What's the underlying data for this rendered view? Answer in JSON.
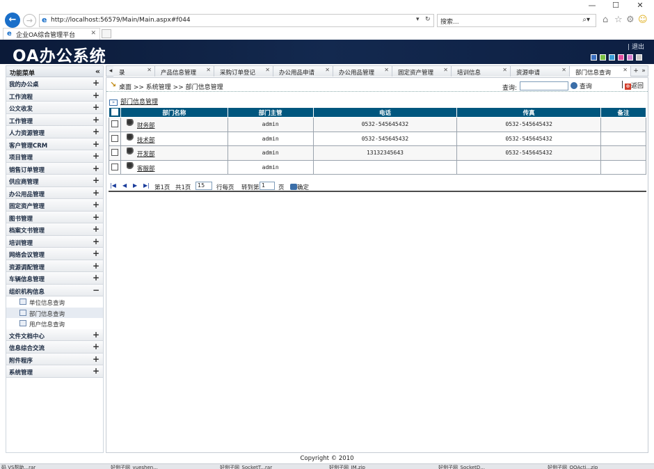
{
  "browser": {
    "address": "http://localhost:56579/Main/Main.aspx#f044",
    "search_placeholder": "搜索...",
    "tab_title": "企业OA综合管理平台",
    "window_min": "—",
    "window_max": "☐",
    "window_close": "✕"
  },
  "app": {
    "title": "OA办公系统",
    "logout": "退出",
    "theme_colors": [
      "#3a6fc0",
      "#7bc043",
      "#3b9dd8",
      "#e24ea0",
      "#d67fd0",
      "#c9c9c9"
    ]
  },
  "sidebar": {
    "title": "功能菜单",
    "collapse_icon": "«",
    "items_top": [
      {
        "label": "我的办公桌",
        "toggle": "+"
      },
      {
        "label": "工作流程",
        "toggle": "+"
      },
      {
        "label": "公文收发",
        "toggle": "+"
      },
      {
        "label": "工作管理",
        "toggle": "+"
      },
      {
        "label": "人力资源管理",
        "toggle": "+"
      },
      {
        "label": "客户管理CRM",
        "toggle": "+"
      },
      {
        "label": "项目管理",
        "toggle": "+"
      },
      {
        "label": "销售订单管理",
        "toggle": "+"
      },
      {
        "label": "供应商管理",
        "toggle": "+"
      },
      {
        "label": "办公用品管理",
        "toggle": "+"
      },
      {
        "label": "固定资产管理",
        "toggle": "+"
      },
      {
        "label": "图书管理",
        "toggle": "+"
      },
      {
        "label": "档案文书管理",
        "toggle": "+"
      },
      {
        "label": "培训管理",
        "toggle": "+"
      },
      {
        "label": "网络会议管理",
        "toggle": "+"
      },
      {
        "label": "资源调配管理",
        "toggle": "+"
      },
      {
        "label": "车辆信息管理",
        "toggle": "+"
      },
      {
        "label": "组织机构信息",
        "toggle": "−"
      }
    ],
    "subitems": [
      {
        "label": "单位信息查询",
        "active": false
      },
      {
        "label": "部门信息查询",
        "active": true
      },
      {
        "label": "用户信息查询",
        "active": false
      }
    ],
    "items_bottom": [
      {
        "label": "文件文档中心",
        "toggle": "+"
      },
      {
        "label": "信息综合交流",
        "toggle": "+"
      },
      {
        "label": "附件程序",
        "toggle": "+"
      },
      {
        "label": "系统管理",
        "toggle": "+"
      }
    ]
  },
  "tabs": {
    "prev": "◂",
    "add": "+",
    "overflow": "»",
    "items": [
      {
        "label": "录",
        "close": "✕",
        "active": false
      },
      {
        "label": "产品信息管理",
        "close": "✕",
        "active": false
      },
      {
        "label": "采购订单登记",
        "close": "✕",
        "active": false
      },
      {
        "label": "办公用品申请",
        "close": "✕",
        "active": false
      },
      {
        "label": "办公用品管理",
        "close": "✕",
        "active": false
      },
      {
        "label": "固定资产管理",
        "close": "✕",
        "active": false
      },
      {
        "label": "培训信息",
        "close": "✕",
        "active": false
      },
      {
        "label": "资源申请",
        "close": "✕",
        "active": false
      },
      {
        "label": "部门信息查询",
        "close": "✕",
        "active": true
      }
    ]
  },
  "breadcrumb": {
    "text": "桌面 >> 系统管理 >> 部门信息管理",
    "query_label": "查询:",
    "query_button": "查询",
    "back_label": "返回"
  },
  "section": {
    "title": "部门信息管理"
  },
  "table": {
    "headers": [
      "部门名称",
      "部门主管",
      "电话",
      "传真",
      "备注"
    ],
    "rows": [
      {
        "name": "财务部",
        "manager": "admin",
        "phone": "0532-545645432",
        "fax": "0532-545645432",
        "note": ""
      },
      {
        "name": "技术部",
        "manager": "admin",
        "phone": "0532-545645432",
        "fax": "0532-545645432",
        "note": ""
      },
      {
        "name": "开发部",
        "manager": "admin",
        "phone": "13132345643",
        "fax": "0532-545645432",
        "note": ""
      },
      {
        "name": "客服部",
        "manager": "admin",
        "phone": "",
        "fax": "",
        "note": ""
      }
    ]
  },
  "pager": {
    "first": "|◀",
    "prev": "◀",
    "next": "▶",
    "last": "▶|",
    "page_text": "第1页",
    "total_text": "共1页",
    "page_size": "15",
    "per_page_label": "行每页",
    "goto_label": "转到第",
    "goto_value": "1",
    "page_unit": "页",
    "confirm": "确定"
  },
  "footer": {
    "copyright": "Copyright © 2010"
  },
  "taskbar": {
    "items": [
      "码 VS帮助...rar",
      "好例子网_yueshen...",
      "好例子网_SocketT...rar",
      "好例子网_IM.zip",
      "好例子网_SocketD...",
      "好例子网_OOActi...zip"
    ]
  }
}
